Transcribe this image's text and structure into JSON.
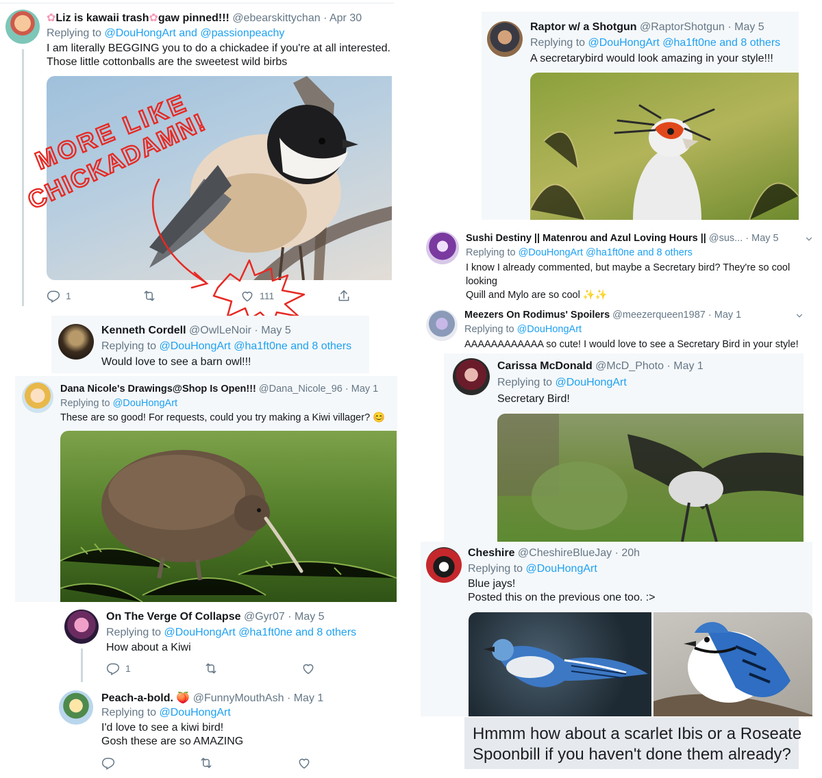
{
  "tweets": [
    {
      "name": "Liz is kawaii trash",
      "name_post": "gaw pinned!!!",
      "handle": "@ebearskittychan",
      "date": "Apr 30",
      "reply_prefix": "Replying to",
      "mentions": "@DouHongArt and @passionpeachy",
      "text": [
        "I am literally BEGGING you to do a chickadee if you're at all interested.",
        "Those little cottonballs are the sweetest wild birbs"
      ],
      "reply_count": "1",
      "like_count": "111"
    },
    {
      "name": "Kenneth Cordell",
      "handle": "@OwlLeNoir",
      "date": "May 5",
      "reply_prefix": "Replying to",
      "mentions": "@DouHongArt @ha1ft0ne and 8 others",
      "text": [
        "Would love to see a barn owl!!!"
      ]
    },
    {
      "name": "Dana Nicole's Drawings@Shop Is Open!!!",
      "handle": "@Dana_Nicole_96",
      "date": "May 1",
      "reply_prefix": "Replying to",
      "mentions": "@DouHongArt",
      "text": [
        "These are so good! For requests, could you try making a Kiwi villager? 😊"
      ]
    },
    {
      "name": "On The Verge Of Collapse",
      "handle": "@Gyr07",
      "date": "May 5",
      "reply_prefix": "Replying to",
      "mentions": "@DouHongArt @ha1ft0ne and 8 others",
      "text": [
        "How about a Kiwi"
      ],
      "reply_count": "1"
    },
    {
      "name": "Peach-a-bold.",
      "emoji": "🍑",
      "handle": "@FunnyMouthAsh",
      "date": "May 1",
      "reply_prefix": "Replying to",
      "mentions": "@DouHongArt",
      "text": [
        "I'd love to see a kiwi bird!",
        "Gosh these are so AMAZING"
      ]
    },
    {
      "name": "Raptor w/ a Shotgun",
      "handle": "@RaptorShotgun",
      "date": "May 5",
      "reply_prefix": "Replying to",
      "mentions": "@DouHongArt @ha1ft0ne and 8 others",
      "text": [
        "A secretarybird would look amazing in your style!!!"
      ]
    },
    {
      "name": "Sushi Destiny || Matenrou and Azul Loving Hours ||",
      "handle": "@sus...",
      "date": "May 5",
      "reply_prefix": "Replying to",
      "mentions": "@DouHongArt @ha1ft0ne and 8 others",
      "text": [
        "I know I already commented, but maybe a Secretary bird? They're so cool",
        "looking",
        "Quill and Mylo are so cool ✨✨"
      ]
    },
    {
      "name": "Meezers On Rodimus' Spoilers",
      "handle": "@meezerqueen1987",
      "date": "May 1",
      "reply_prefix": "Replying to",
      "mentions": "@DouHongArt",
      "text": [
        "AAAAAAAAAAAA so cute!  I would love to see a Secretary Bird in your style!"
      ]
    },
    {
      "name": "Carissa McDonald",
      "handle": "@McD_Photo",
      "date": "May 1",
      "reply_prefix": "Replying to",
      "mentions": "@DouHongArt",
      "text": [
        "Secretary Bird!"
      ]
    },
    {
      "name": "Cheshire",
      "handle": "@CheshireBlueJay",
      "date": "20h",
      "reply_prefix": "Replying to",
      "mentions": "@DouHongArt",
      "text": [
        "Blue jays!",
        "Posted this on the previous one too. :>"
      ]
    }
  ],
  "annotation": {
    "line1": "MORE LIKE",
    "line2": "CHICKADAMN!"
  },
  "comment_box": {
    "line1": "Hmmm how about a scarlet Ibis or a Roseate",
    "line2": "Spoonbill if you haven't done them already?"
  },
  "colors": {
    "link": "#1da1f2",
    "muted": "#657786",
    "annotation": "#e62a24",
    "card_gray": "#f5f8fa"
  }
}
